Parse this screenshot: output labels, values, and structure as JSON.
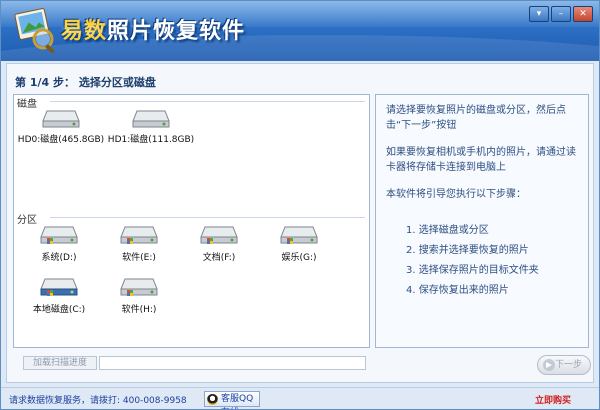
{
  "window": {
    "title": "易数照片恢复软件",
    "title_accent": "易数",
    "title_rest": "照片恢复软件",
    "controls": [
      "minimize-icon",
      "maximize-icon",
      "close-icon"
    ]
  },
  "step": {
    "title": "第 1/4 步： 选择分区或磁盘"
  },
  "disks_group": {
    "label": "磁盘",
    "items": [
      {
        "label": "HD0:磁盘(465.8GB)"
      },
      {
        "label": "HD1:磁盘(111.8GB)"
      }
    ]
  },
  "partitions_group": {
    "label": "分区",
    "items": [
      {
        "label": "系统(D:)"
      },
      {
        "label": "软件(E:)"
      },
      {
        "label": "文档(F:)"
      },
      {
        "label": "娱乐(G:)"
      },
      {
        "label": "本地磁盘(C:)"
      },
      {
        "label": "软件(H:)"
      }
    ]
  },
  "info": {
    "intro": "请选择要恢复照片的磁盘或分区，然后点击“下一步”按钮",
    "phone": "如果要恢复相机或手机内的照片，请通过读卡器将存储卡连接到电脑上",
    "steps_intro": "本软件将引导您执行以下步骤：",
    "steps": [
      "1.  选择磁盘或分区",
      "2.  搜索并选择要恢复的照片",
      "3.  选择保存照片的目标文件夹",
      "4.  保存恢复出来的照片"
    ]
  },
  "progress": {
    "load_label": "加载扫描进度",
    "value": 0
  },
  "next_button": {
    "label": "下一步"
  },
  "status": {
    "service_text": "请求数据恢复服务，请拨打: 400-008-9958",
    "qq_label": "客服QQ在线",
    "buy_label": "立即购买"
  },
  "colors": {
    "titlebar": "#2c6fc4",
    "accent_title": "#ffd23c",
    "info_text": "#2d4f82",
    "buy_link": "#d21f1f"
  }
}
